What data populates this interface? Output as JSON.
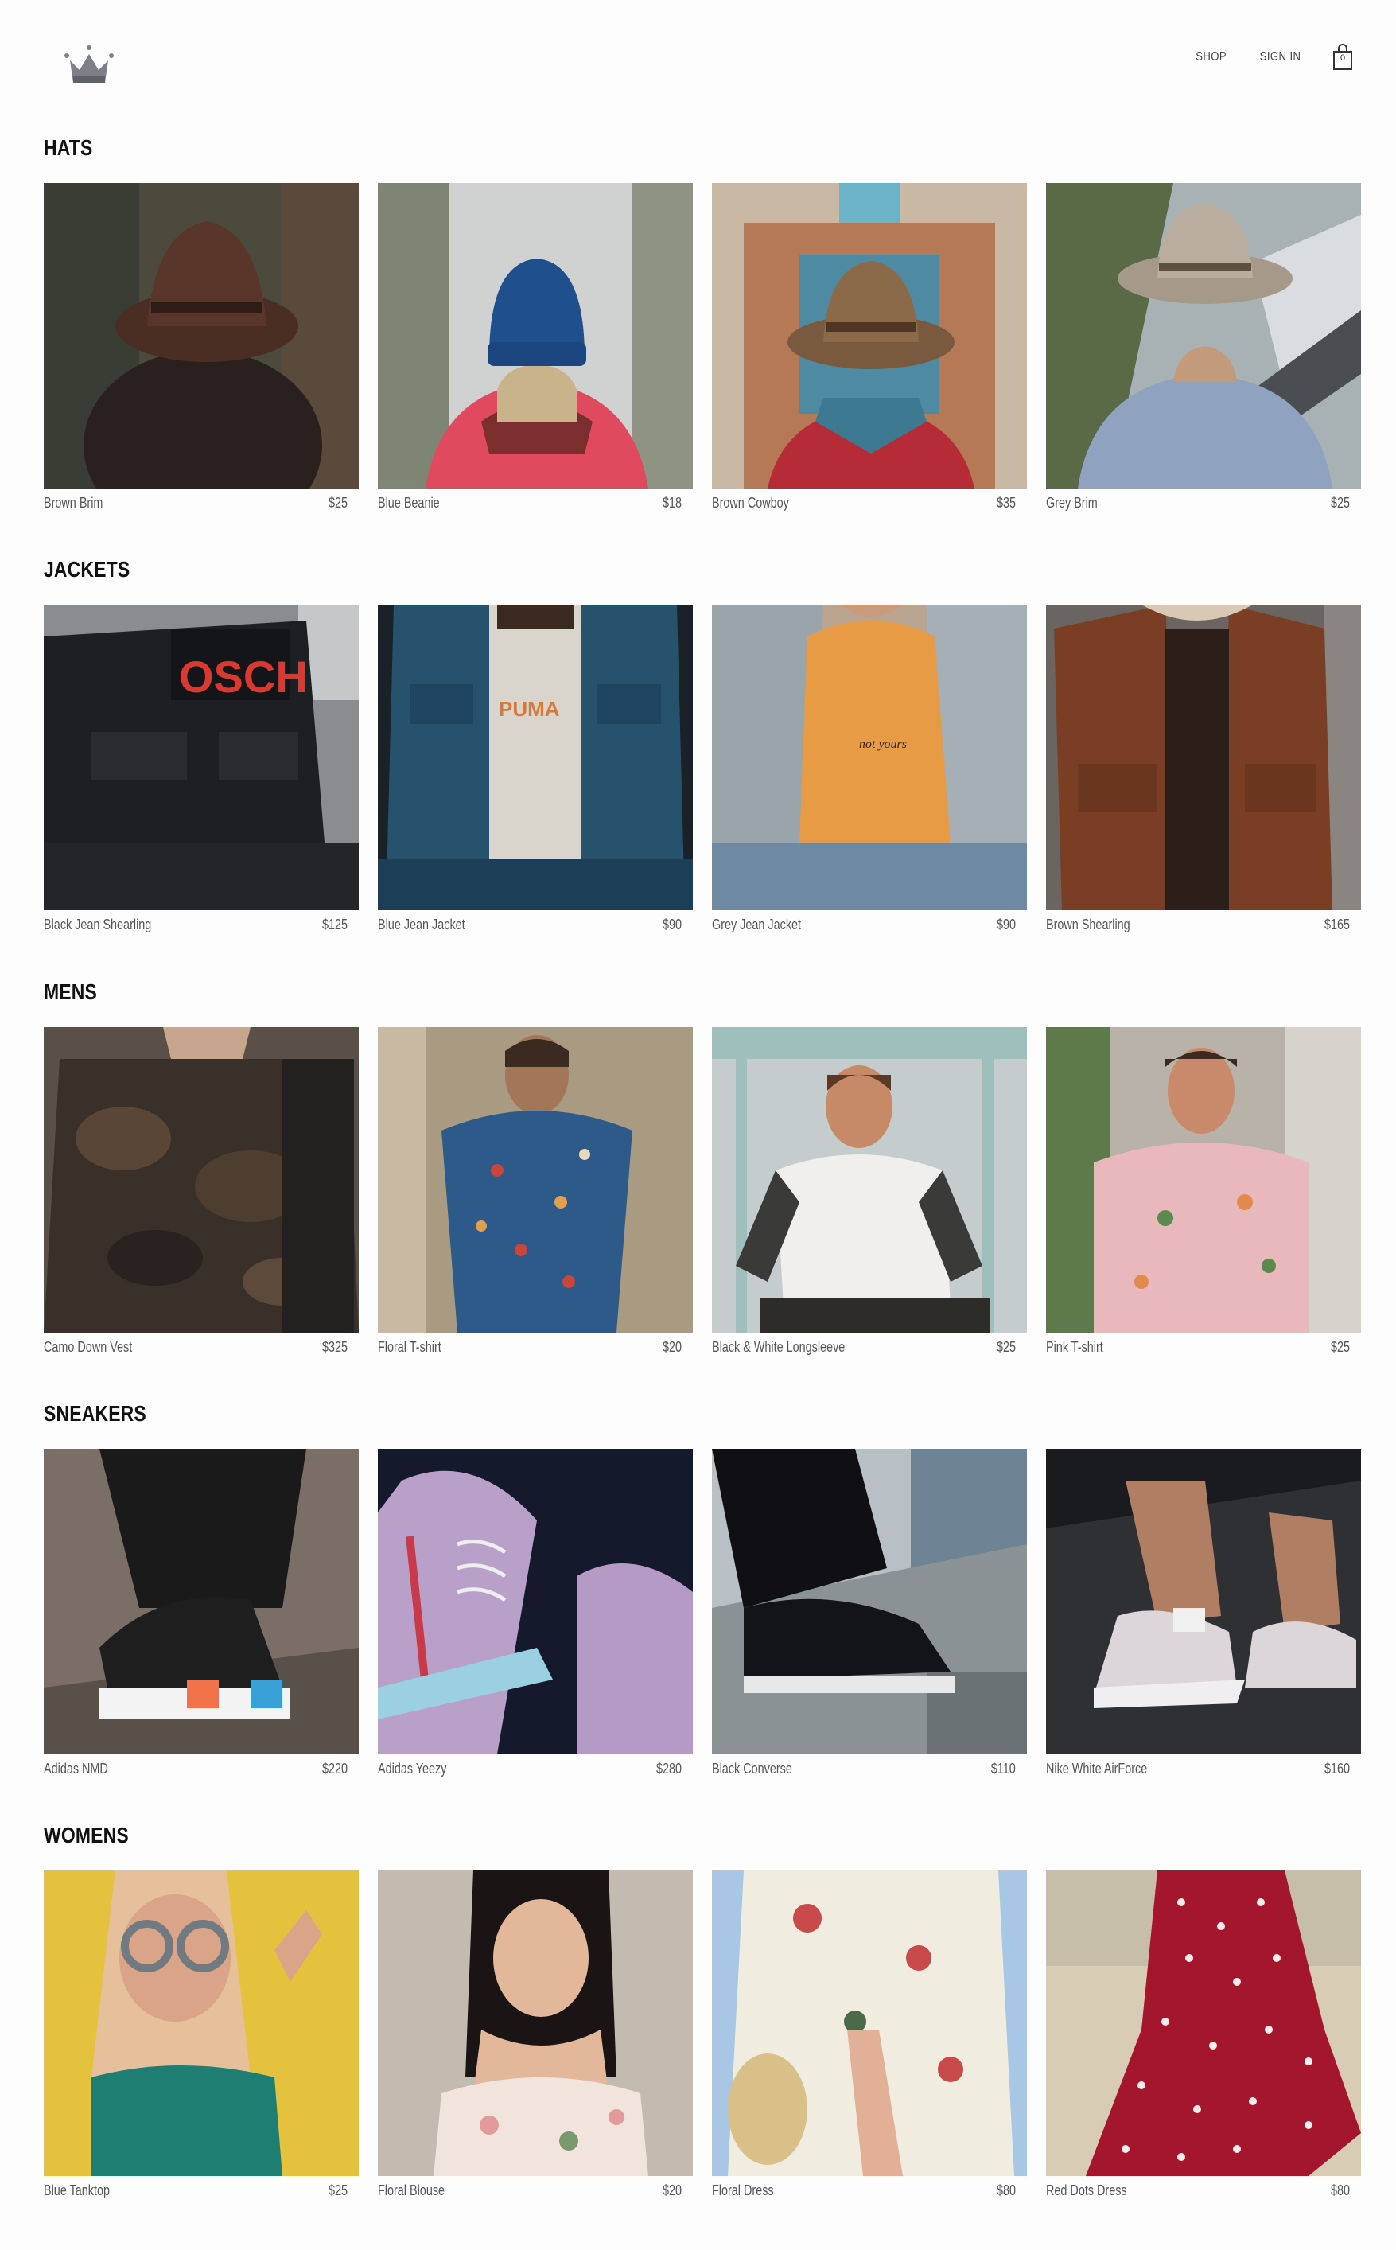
{
  "header": {
    "logo": "crown-logo",
    "nav": {
      "shop": "SHOP",
      "sign_in": "SIGN IN"
    },
    "cart": {
      "icon": "shopping-bag-icon",
      "count": "0"
    }
  },
  "sections": [
    {
      "title": "HATS",
      "items": [
        {
          "name": "Brown Brim",
          "price": "$25"
        },
        {
          "name": "Blue Beanie",
          "price": "$18"
        },
        {
          "name": "Brown Cowboy",
          "price": "$35"
        },
        {
          "name": "Grey Brim",
          "price": "$25"
        }
      ]
    },
    {
      "title": "JACKETS",
      "items": [
        {
          "name": "Black Jean Shearling",
          "price": "$125"
        },
        {
          "name": "Blue Jean Jacket",
          "price": "$90"
        },
        {
          "name": "Grey Jean Jacket",
          "price": "$90"
        },
        {
          "name": "Brown Shearling",
          "price": "$165"
        }
      ]
    },
    {
      "title": "MENS",
      "items": [
        {
          "name": "Camo Down Vest",
          "price": "$325"
        },
        {
          "name": "Floral T-shirt",
          "price": "$20"
        },
        {
          "name": "Black & White Longsleeve",
          "price": "$25"
        },
        {
          "name": "Pink T-shirt",
          "price": "$25"
        }
      ]
    },
    {
      "title": "SNEAKERS",
      "items": [
        {
          "name": "Adidas NMD",
          "price": "$220"
        },
        {
          "name": "Adidas Yeezy",
          "price": "$280"
        },
        {
          "name": "Black Converse",
          "price": "$110"
        },
        {
          "name": "Nike White AirForce",
          "price": "$160"
        }
      ]
    },
    {
      "title": "WOMENS",
      "items": [
        {
          "name": "Blue Tanktop",
          "price": "$25"
        },
        {
          "name": "Floral Blouse",
          "price": "$20"
        },
        {
          "name": "Floral Dress",
          "price": "$80"
        },
        {
          "name": "Red Dots Dress",
          "price": "$80"
        }
      ]
    }
  ]
}
